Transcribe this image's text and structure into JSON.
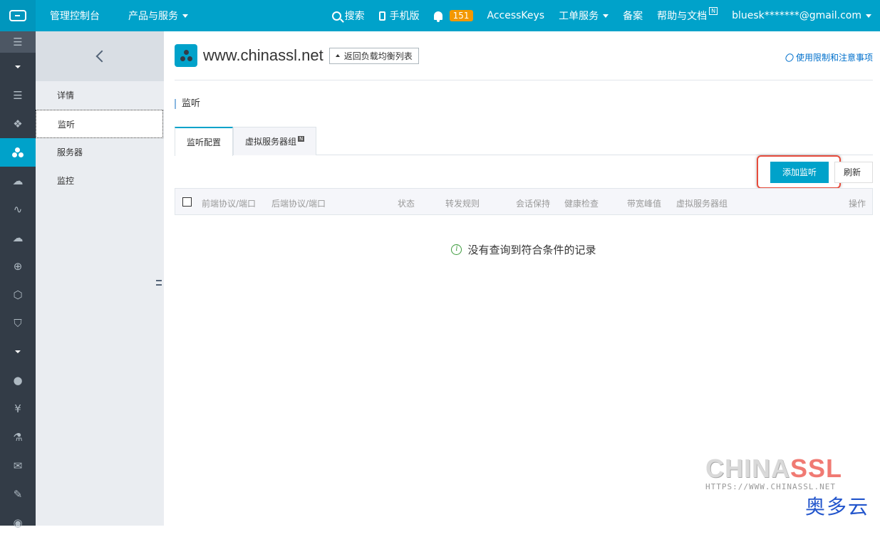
{
  "topbar": {
    "console": "管理控制台",
    "products": "产品与服务",
    "search": "搜索",
    "mobile": "手机版",
    "notifications": "151",
    "accesskeys": "AccessKeys",
    "tickets": "工单服务",
    "filing": "备案",
    "help": "帮助与文档",
    "help_badge": "N",
    "account": "bluesk*******@gmail.com"
  },
  "subnav": {
    "items": [
      "详情",
      "监听",
      "服务器",
      "监控"
    ],
    "active": "监听"
  },
  "header": {
    "title": "www.chinassl.net",
    "back_label": "返回负载均衡列表",
    "limits_link": "使用限制和注意事项"
  },
  "section_title": "监听",
  "tabs": [
    {
      "label": "监听配置",
      "active": true
    },
    {
      "label": "虚拟服务器组",
      "badge": "N",
      "active": false
    }
  ],
  "toolbar": {
    "add_label": "添加监听",
    "refresh_label": "刷新"
  },
  "table": {
    "columns": [
      "前端协议/端口",
      "后端协议/端口",
      "状态",
      "转发规则",
      "会话保持",
      "健康检查",
      "带宽峰值",
      "虚拟服务器组",
      "操作"
    ],
    "empty_message": "没有查询到符合条件的记录"
  },
  "watermark": {
    "logo_a": "CHINA",
    "logo_b": "SSL",
    "url": "HTTPS://WWW.CHINASSL.NET",
    "cn": "奥多云"
  },
  "colors": {
    "topbar": "#00a2ca",
    "sidebar": "#333c47",
    "accent": "#00a2ca",
    "highlight": "#e74c3c"
  }
}
